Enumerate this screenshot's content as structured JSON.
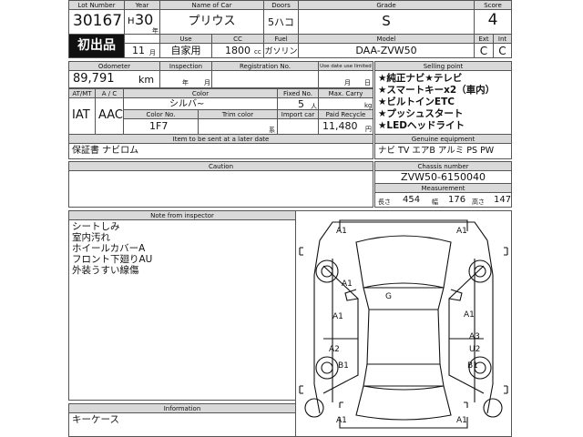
{
  "headers": {
    "lot_number": "Lot Number",
    "year": "Year",
    "name_of_car": "Name of Car",
    "doors": "Doors",
    "grade": "Grade",
    "score": "Score",
    "use": "Use",
    "cc": "CC",
    "fuel": "Fuel",
    "model": "Model",
    "ext": "Ext",
    "int": "Int",
    "odometer": "Odometer",
    "inspection": "Inspection",
    "registration_no": "Registration No.",
    "use_date_limit": "Use date use limited",
    "selling_point": "Selling point",
    "atmt": "AT/MT",
    "ac": "A / C",
    "color": "Color",
    "fixed_no": "Fixed No.",
    "max_carry": "Max. Carry",
    "color_no": "Color No.",
    "trim_color": "Trim color",
    "import_car": "Import car",
    "paid_recycle": "Paid Recycle",
    "item_later": "Item to be sent at a later date",
    "genuine_equipment": "Genuine equipment",
    "caution": "Caution",
    "chassis_number": "Chassis number",
    "measurement": "Measurement",
    "note_from_inspector": "Note from inspector",
    "information": "Information"
  },
  "lot": {
    "lot_number": "30167",
    "year_era": "H",
    "year_num": "30",
    "year_suffix": "年",
    "car_name": "プリウス",
    "doors": "5ハコ",
    "grade": "S",
    "score": "4",
    "first_reg_badge": "初出品",
    "month": "11",
    "month_suffix": "月",
    "use": "自家用",
    "cc": "1800",
    "cc_unit": "cc",
    "fuel": "ガソリン",
    "model": "DAA-ZVW50",
    "ext_grade": "C",
    "int_grade": "C"
  },
  "odometer": {
    "value": "89,791",
    "unit": "km"
  },
  "inspection": {
    "year_label": "年",
    "month_label": "月"
  },
  "registration": {
    "month_label": "月",
    "day_label": "日"
  },
  "vehicle": {
    "atmt": "IAT",
    "ac": "AAC",
    "color": "シルバ~",
    "fixed_no": "5",
    "fixed_unit": "人",
    "max_carry_unit": "kg",
    "color_no": "1F7",
    "trim_unit": "系",
    "recycle_fee": "11,480",
    "recycle_unit": "円"
  },
  "selling_points": [
    "★純正ナビ★テレビ",
    "★スマートキーx2（車内）",
    "★ビルトインETC",
    "★プッシュスタート",
    "★LEDヘッドライト"
  ],
  "later_items": "保証書 ナビロム",
  "genuine_equipment": "ナビ TV エアB アルミ PS PW",
  "chassis": "ZVW50-6150040",
  "measurement": {
    "length_label": "長さ",
    "length": "454",
    "width_label": "幅",
    "width": "176",
    "height_label": "高さ",
    "height": "147"
  },
  "inspector_notes": [
    "シートしみ",
    "室内汚れ",
    "ホイールカバーA",
    "フロント下廻りAU",
    "外装うすい線傷"
  ],
  "information": "キーケース",
  "damage_marks": [
    {
      "code": "A1",
      "area": "front-left-fender"
    },
    {
      "code": "A1",
      "area": "front-bumper-right"
    },
    {
      "code": "A1",
      "area": "left-front-door"
    },
    {
      "code": "G",
      "area": "windshield"
    },
    {
      "code": "A1",
      "area": "left-rear-door"
    },
    {
      "code": "A1",
      "area": "right-front-door"
    },
    {
      "code": "A2",
      "area": "left-quarter"
    },
    {
      "code": "A3",
      "area": "right-rear-door"
    },
    {
      "code": "U2",
      "area": "right-quarter"
    },
    {
      "code": "B1",
      "area": "left-rear-wheel"
    },
    {
      "code": "B1",
      "area": "right-rear-wheel"
    },
    {
      "code": "A1",
      "area": "rear-bumper-left"
    },
    {
      "code": "A1",
      "area": "rear-bumper-right"
    }
  ]
}
